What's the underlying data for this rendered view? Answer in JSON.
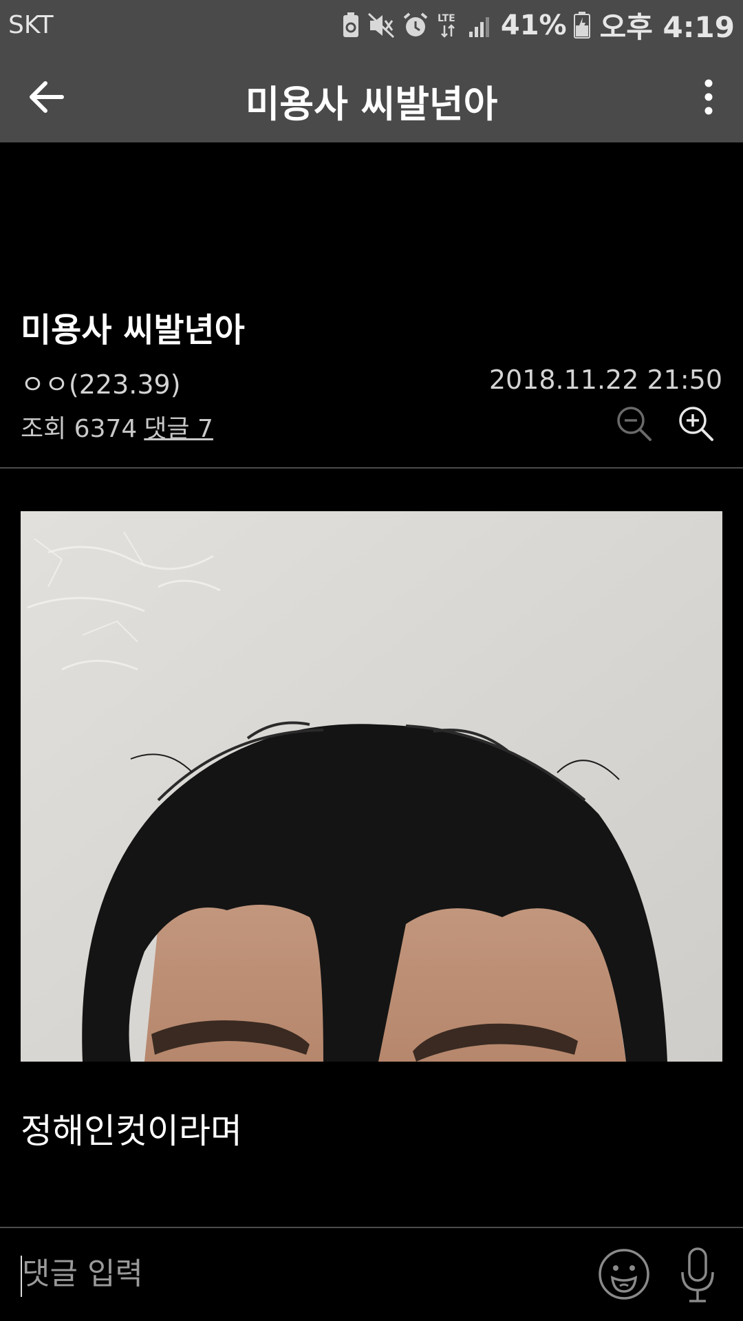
{
  "status_bar": {
    "carrier": "SKT",
    "network": "LTE",
    "battery_percent": "41%",
    "time": "오후 4:19",
    "icons": [
      "recycle-icon",
      "mute-icon",
      "alarm-icon",
      "lte-icon",
      "signal-icon",
      "battery-icon"
    ]
  },
  "app_bar": {
    "title": "미용사 씨발년아",
    "back_icon": "arrow-left-icon",
    "more_icon": "more-vertical-icon"
  },
  "post": {
    "title": "미용사 씨발년아",
    "author": "ㅇㅇ(223.39)",
    "date": "2018.11.22 21:50",
    "views_label": "조회 6374",
    "comments_label": "댓글 7",
    "body": "정해인컷이라며"
  },
  "comment_bar": {
    "placeholder": "댓글 입력",
    "emoji_icon": "emoji-icon",
    "mic_icon": "microphone-icon"
  },
  "colors": {
    "bar_background": "#4a4a4a",
    "page_background": "#000000",
    "text_primary": "#ffffff",
    "text_secondary": "#d4d4d4"
  }
}
